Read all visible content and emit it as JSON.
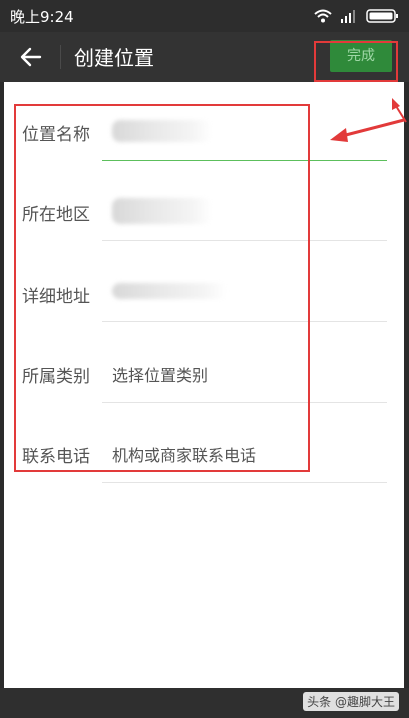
{
  "status_bar": {
    "time": "晚上9:24",
    "icons": [
      "wifi-icon",
      "signal-icon",
      "battery-icon"
    ]
  },
  "app_bar": {
    "title": "创建位置",
    "done_label": "完成",
    "back_icon": "arrow-left-icon"
  },
  "form": {
    "rows": [
      {
        "label": "位置名称",
        "value": "",
        "blurred": true
      },
      {
        "label": "所在地区",
        "value": "",
        "blurred": true
      },
      {
        "label": "详细地址",
        "value": "",
        "blurred": true
      },
      {
        "label": "所属类别",
        "value": "选择位置类别",
        "blurred": false
      },
      {
        "label": "联系电话",
        "value": "机构或商家联系电话",
        "blurred": false
      }
    ]
  },
  "watermark": "头条 @趣脚大王",
  "colors": {
    "accent_green": "#2f8a3a",
    "annotation_red": "#e23a3a",
    "app_bar_bg": "#333333"
  }
}
